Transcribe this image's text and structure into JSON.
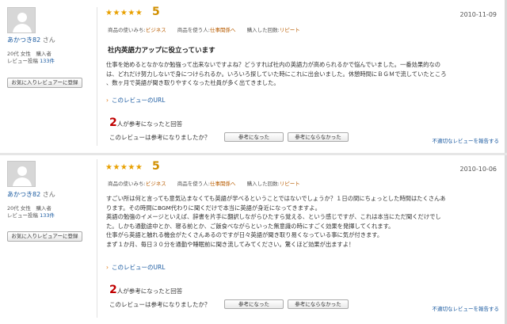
{
  "reviews": [
    {
      "user": {
        "name": "あかつき82",
        "suffix": "さん",
        "info_line1": "20代 女性　購入者",
        "info_line2_label": "レビュー投稿",
        "info_line2_count": "133件",
        "fav_button": "お気に入りレビュアーに登録"
      },
      "stars": "★★★★★",
      "score": "5",
      "date": "2010-11-09",
      "meta": {
        "usage_label": "商品の使いみち:",
        "usage_value": "ビジネス",
        "for_label": "商品を使う人:",
        "for_value": "仕事関係へ",
        "times_label": "購入した回数:",
        "times_value": "リピート"
      },
      "title": "社内英語力アップに役立っています",
      "body": [
        "仕事を始めるとなかなか勉強って出来ないですよね？どうすれば社内の英語力が高められるかで悩んでいました。一番効果的なの",
        "は、どれだけ努力しないで身につけられるか。いろいろ探していた時にこれに出会いました。休憩時間にＢＧＭで流していたところ",
        "、数ヶ月で英語が聞き取りやすくなった社員が多く出てきました。"
      ],
      "url_link": "このレビューのURL",
      "helpful_count": "2",
      "helpful_text": "人が参考になったと回答",
      "question": "このレビューは参考になりましたか？",
      "yes_button": "参考になった",
      "no_button": "参考にならなかった",
      "report_link": "不適切なレビューを報告する"
    },
    {
      "user": {
        "name": "あかつき82",
        "suffix": "さん",
        "info_line1": "20代 女性　購入者",
        "info_line2_label": "レビュー投稿",
        "info_line2_count": "133件",
        "fav_button": "お気に入りレビュアーに登録"
      },
      "stars": "★★★★★",
      "score": "5",
      "date": "2010-10-06",
      "meta": {
        "usage_label": "商品の使いみち:",
        "usage_value": "ビジネス",
        "for_label": "商品を使う人:",
        "for_value": "仕事関係へ",
        "times_label": "購入した回数:",
        "times_value": "リピート"
      },
      "body": [
        "すごい所は何と言っても意気込まなくても英語が学べるということではないでしょうか？１日の間にちょっとした時間はたくさんあ",
        "ります。その時間にBGM代わりに聞くだけで本当に英語が身近になってきますよ。",
        "英語の勉強のイメージといえば、辞書を片手に翻訳しながらひたすら覚える、という感じですが、これは本当にただ聞くだけでし",
        "た。しかも通勤途中とか、寝る前とか、ご飯食べながらといった無意識の時にすごく効果を発揮してくれます。",
        "仕事がら英語と触れる機会がたくさんあるのですが日々英語が聞き取り易くなっている事に気が付きます。",
        "まず１か月、毎日３０分を通勤や睡眠前に聞き流してみてください。驚くほど効果が出ますよ！"
      ],
      "url_link": "このレビューのURL",
      "helpful_count": "2",
      "helpful_text": "人が参考になったと回答",
      "question": "このレビューは参考になりましたか？",
      "yes_button": "参考になった",
      "no_button": "参考にならなかった",
      "report_link": "不適切なレビューを報告する"
    }
  ],
  "icons": {
    "avatar": "user-silhouette-icon",
    "star": "star-icon",
    "link_arrow": "arrow-right-icon"
  },
  "colors": {
    "star": "#e8a000",
    "score": "#d18f00",
    "link": "#1a5aa0",
    "meta_link": "#b85c00",
    "helpful_count": "#c00000"
  }
}
